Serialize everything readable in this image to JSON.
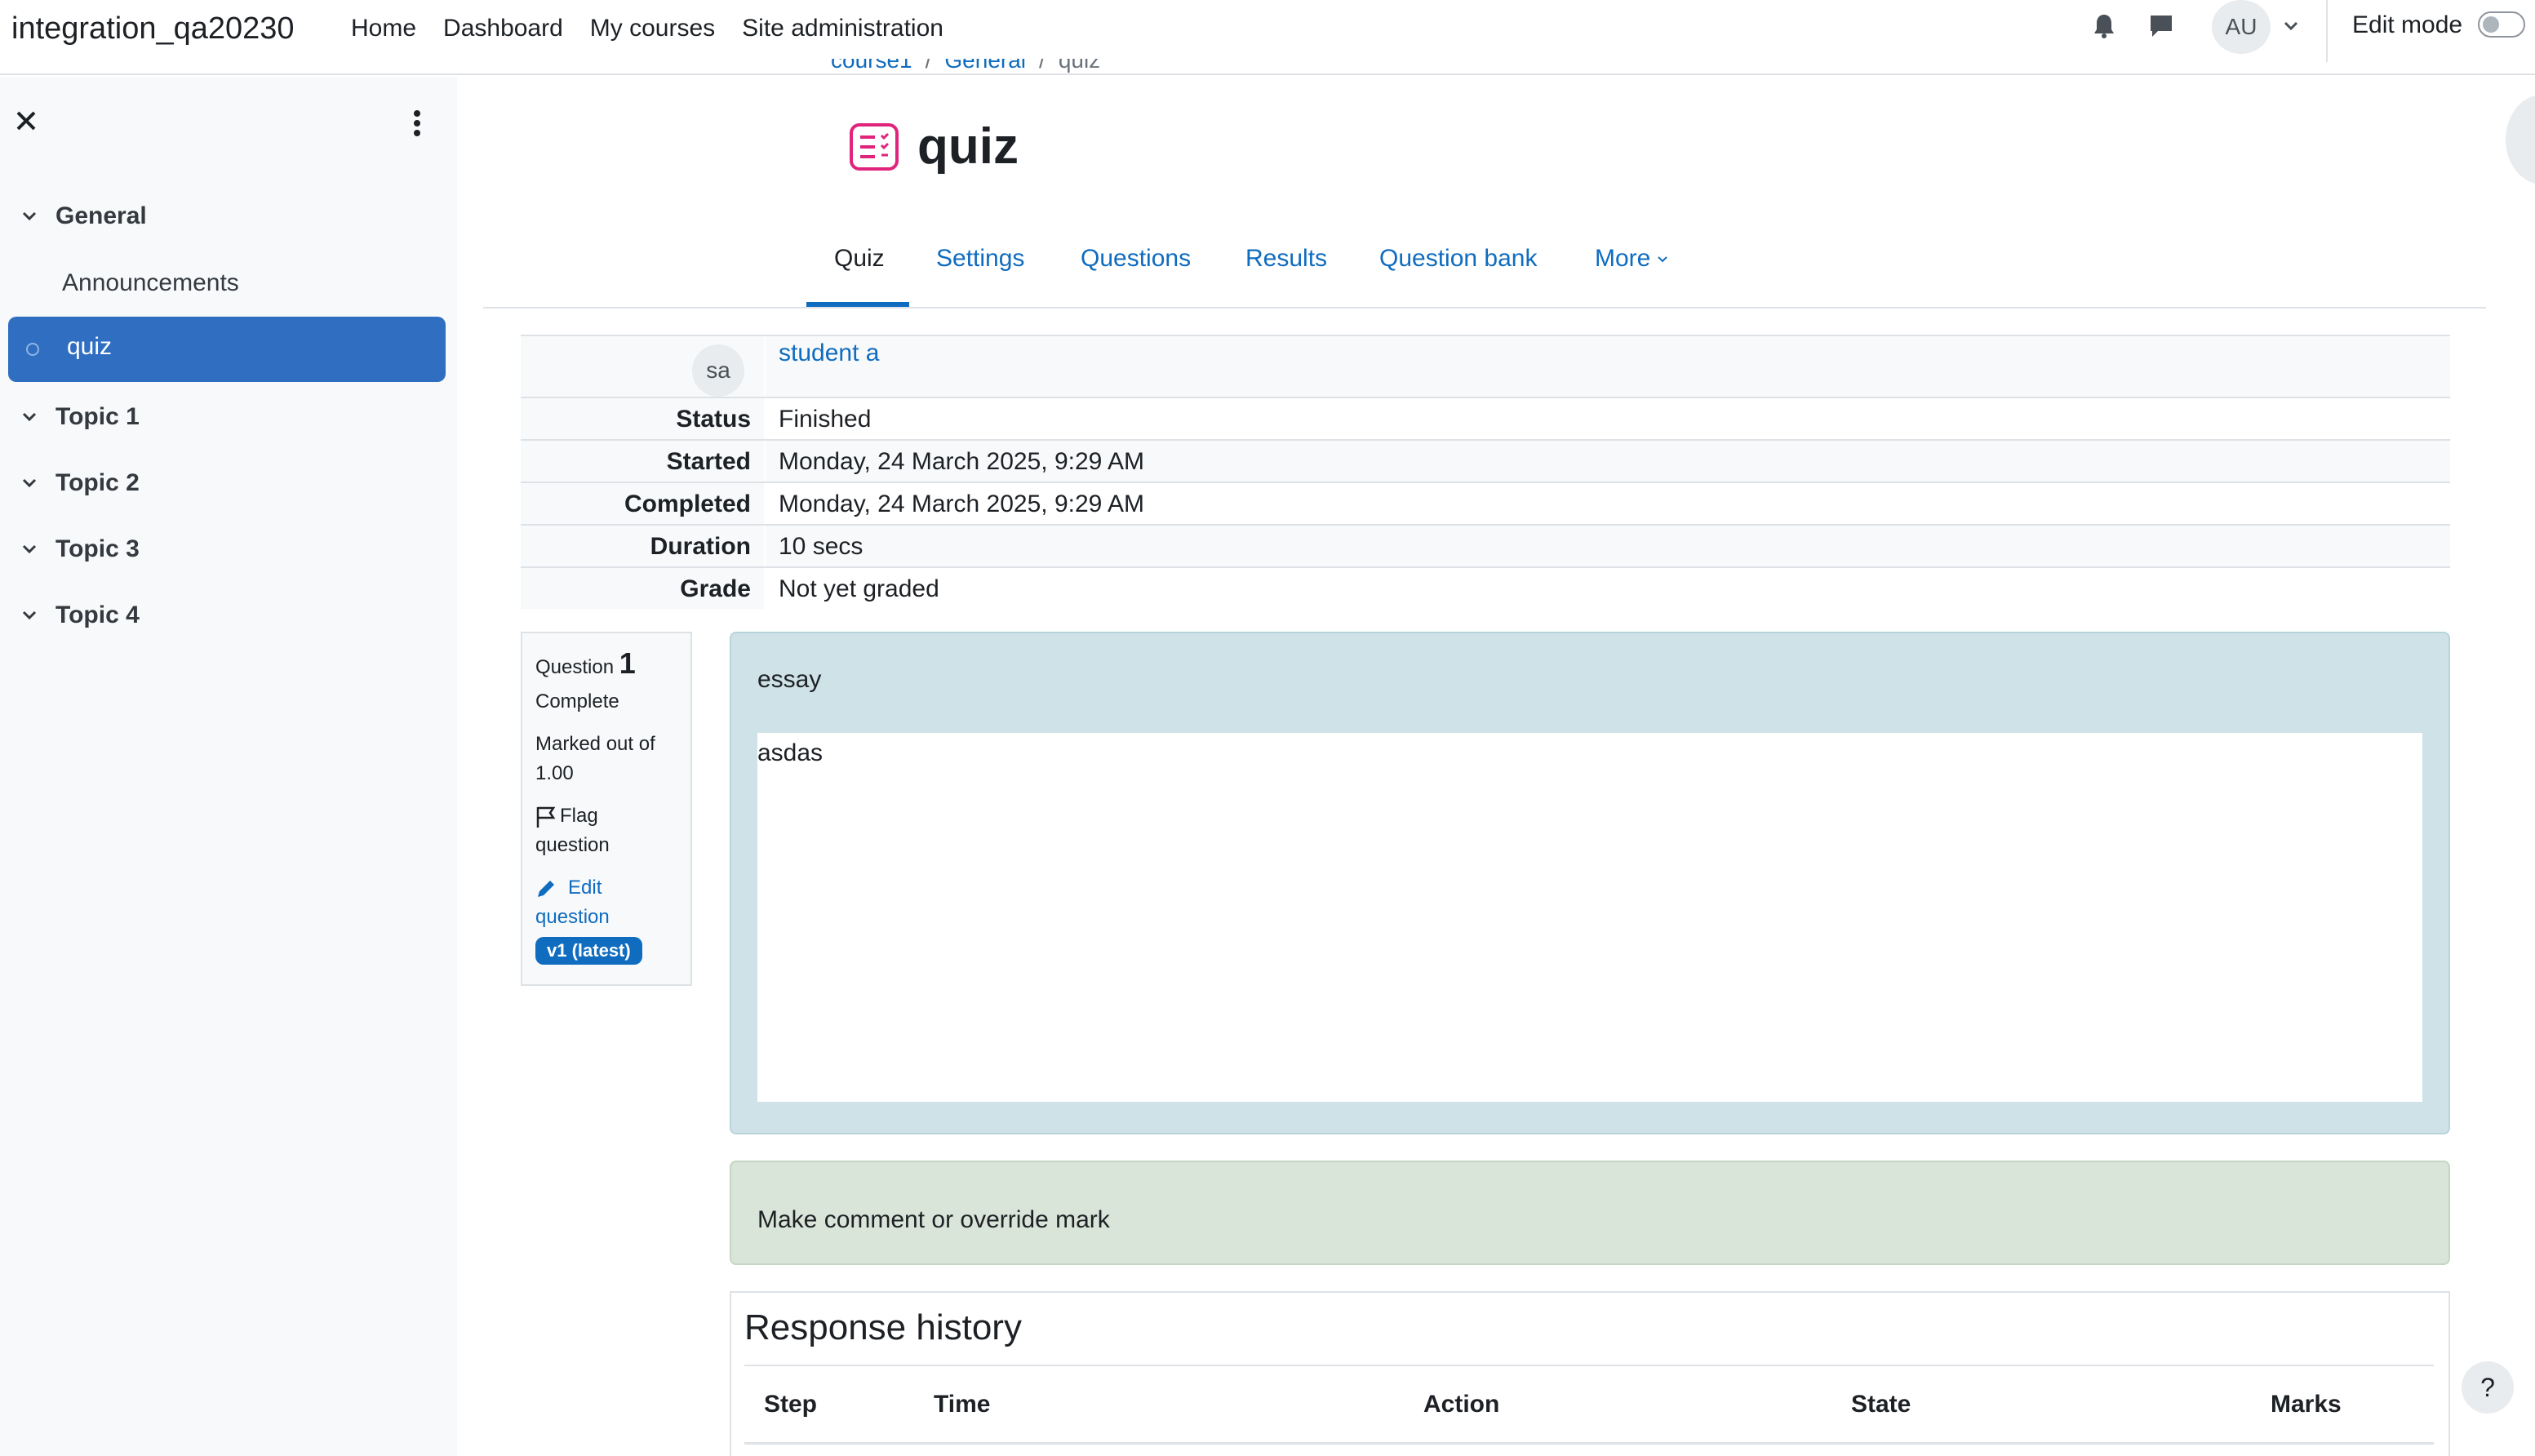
{
  "navbar": {
    "site_name": "integration_qa20230",
    "links": [
      "Home",
      "Dashboard",
      "My courses",
      "Site administration"
    ],
    "user_initials": "AU",
    "edit_mode_label": "Edit mode"
  },
  "drawer": {
    "sections": [
      {
        "label": "General",
        "items": [
          "Announcements",
          "quiz"
        ]
      },
      {
        "label": "Topic 1"
      },
      {
        "label": "Topic 2"
      },
      {
        "label": "Topic 3"
      },
      {
        "label": "Topic 4"
      }
    ],
    "active_item": "quiz",
    "accent_color": "#2f6ec1"
  },
  "breadcrumb": {
    "items": [
      "course1",
      "General",
      "quiz"
    ]
  },
  "page": {
    "title": "quiz",
    "icon": "quiz-icon",
    "icon_color": "#e0247c"
  },
  "tabs": [
    {
      "label": "Quiz",
      "active": true
    },
    {
      "label": "Settings"
    },
    {
      "label": "Questions"
    },
    {
      "label": "Results"
    },
    {
      "label": "Question bank"
    },
    {
      "label": "More"
    }
  ],
  "summary": {
    "user_initials": "sa",
    "user_name": "student a",
    "rows": [
      {
        "label": "Status",
        "value": "Finished"
      },
      {
        "label": "Started",
        "value": "Monday, 24 March 2025, 9:29 AM"
      },
      {
        "label": "Completed",
        "value": "Monday, 24 March 2025, 9:29 AM"
      },
      {
        "label": "Duration",
        "value": "10 secs"
      },
      {
        "label": "Grade",
        "value": "Not yet graded"
      }
    ]
  },
  "question_info": {
    "label": "Question",
    "number": "1",
    "state": "Complete",
    "marked_out_of_line1": "Marked out of",
    "marked_out_of_line2": "1.00",
    "flag_line1": "Flag",
    "flag_line2": "question",
    "edit_line1": "Edit",
    "edit_line2": "question",
    "version_badge": "v1 (latest)"
  },
  "question": {
    "text": "essay",
    "answer": "asdas"
  },
  "comment": {
    "link": "Make comment or override mark"
  },
  "history": {
    "title": "Response history",
    "columns": [
      "Step",
      "Time",
      "Action",
      "State",
      "Marks"
    ]
  },
  "help": "?"
}
